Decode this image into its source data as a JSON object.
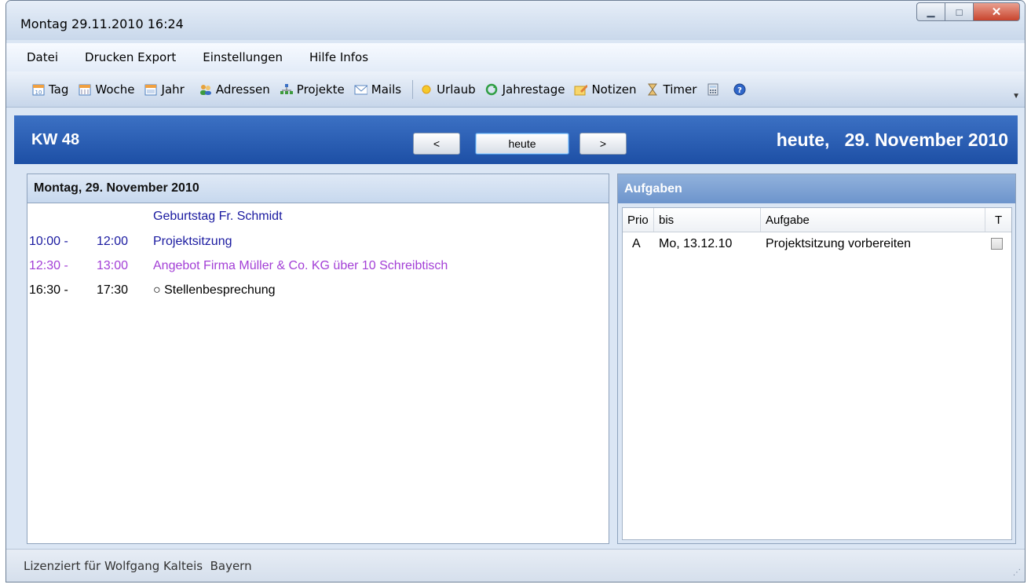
{
  "window": {
    "title": "Montag 29.11.2010 16:24"
  },
  "menu": [
    "Datei",
    "Drucken Export",
    "Einstellungen",
    "Hilfe Infos"
  ],
  "toolbar": {
    "tag": "Tag",
    "woche": "Woche",
    "jahr": "Jahr",
    "adressen": "Adressen",
    "projekte": "Projekte",
    "mails": "Mails",
    "urlaub": "Urlaub",
    "jahrestage": "Jahrestage",
    "notizen": "Notizen",
    "timer": "Timer"
  },
  "header": {
    "week": "KW 48",
    "prev": "<",
    "today_btn": "heute",
    "next": ">",
    "today_label": "heute,   29. November 2010"
  },
  "day": {
    "title": "Montag, 29. November 2010",
    "entries": [
      {
        "start": "",
        "end": "",
        "text": "Geburtstag Fr. Schmidt",
        "color": "#1a1aa0"
      },
      {
        "start": "10:00 -",
        "end": "12:00",
        "text": "Projektsitzung",
        "color": "#1a1aa0"
      },
      {
        "start": "12:30 -",
        "end": "13:00",
        "text": "Angebot Firma Müller & Co. KG über 10 Schreibtisch",
        "color": "#a33fd6"
      },
      {
        "start": "16:30 -",
        "end": "17:30",
        "text": "○ Stellenbesprechung",
        "color": "#000000"
      }
    ]
  },
  "tasks": {
    "title": "Aufgaben",
    "columns": {
      "prio": "Prio",
      "bis": "bis",
      "aufgabe": "Aufgabe",
      "t": "T"
    },
    "rows": [
      {
        "prio": "A",
        "bis": "Mo, 13.12.10",
        "aufgabe": "Projektsitzung vorbereiten",
        "done": false
      }
    ]
  },
  "status": {
    "text": "Lizenziert für Wolfgang Kalteis  Bayern"
  }
}
